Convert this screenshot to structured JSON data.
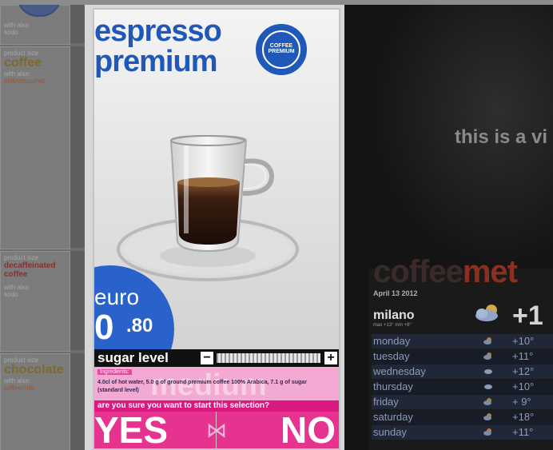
{
  "colors": {
    "brand_blue": "#1f58b8",
    "magenta": "#e5338f",
    "pink_panel": "#f2a9d2",
    "dark": "#111111"
  },
  "sidebar": {
    "items": [
      {
        "small": "with also",
        "name": "",
        "sub": "sodo"
      },
      {
        "small": "product size",
        "name": "coffee",
        "sub": "with also",
        "sub2": "milk/choco/net"
      },
      {
        "small": "product size",
        "name": "decaffeinated coffee",
        "sub": "with also",
        "sub2": "sodo"
      },
      {
        "small": "product size",
        "name": "chocolate",
        "sub": "with also",
        "sub2": "coffee/milk"
      }
    ]
  },
  "product": {
    "title_line1": "espresso",
    "title_line2": "premium",
    "seal_text": "COFFEE PREMIUM",
    "price_currency": "euro",
    "price_whole": "0",
    "price_cents": ".80",
    "sugar_label": "sugar level",
    "sugar_minus": "−",
    "sugar_plus": "+",
    "ingredients_header": "Ingredients:",
    "ingredients_text": "4.0cl of hot water, 5.0 g of ground premium coffee 100% Arabica, 7.1 g of sugar (standard level)",
    "ingredients_ghost": "medium",
    "question": "are you sure you want to start this selection?",
    "yes_label": "YES",
    "no_label": "NO"
  },
  "right_screen": {
    "promo": "this is a vi",
    "brand_a": "coffee",
    "brand_b": "met",
    "date": "April 13 2012",
    "city": "milano",
    "city_sub": "max +13° min +8°",
    "big_temp": "+1",
    "weather_icon": "cloudy-sun-icon",
    "forecast": [
      {
        "day": "monday",
        "temp": "+10°"
      },
      {
        "day": "tuesday",
        "temp": "+11°"
      },
      {
        "day": "wednesday",
        "temp": "+12°"
      },
      {
        "day": "thursday",
        "temp": "+10°"
      },
      {
        "day": "friday",
        "temp": "+ 9°"
      },
      {
        "day": "saturday",
        "temp": "+18°"
      },
      {
        "day": "sunday",
        "temp": "+11°"
      }
    ]
  }
}
